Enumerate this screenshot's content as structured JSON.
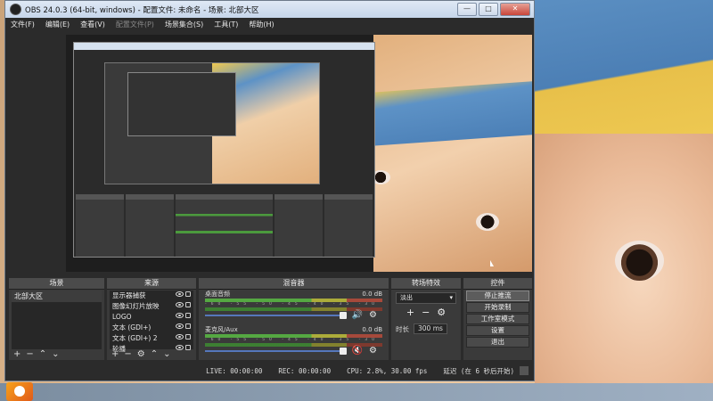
{
  "window": {
    "title": "OBS 24.0.3 (64-bit, windows) - 配置文件: 未命名 - 场景: 北部大区",
    "controls": [
      "—",
      "□",
      "✕"
    ]
  },
  "menu": [
    "文件(F)",
    "编辑(E)",
    "查看(V)",
    "配置文件(P)",
    "场景集合(S)",
    "工具(T)",
    "帮助(H)"
  ],
  "docks": {
    "scenes": {
      "title": "场景",
      "items": [
        "北部大区"
      ]
    },
    "sources": {
      "title": "来源",
      "items": [
        "显示器捕获",
        "图像幻灯片放映",
        "LOGO",
        "文本 (GDI+)",
        "文本 (GDI+) 2",
        "轮播"
      ]
    },
    "mixer": {
      "title": "混音器",
      "tracks": [
        {
          "name": "桌面音频",
          "db": "0.0 dB",
          "muted": false,
          "level": 0.62
        },
        {
          "name": "麦克风/Aux",
          "db": "0.0 dB",
          "muted": true,
          "level": 0.58
        }
      ],
      "scale": "-60 -55 -50 -45 -40 -35 -30 -25 -20 -15 -10 -5 0"
    },
    "transitions": {
      "title": "转场特效",
      "selected": "淡出",
      "duration_label": "时长",
      "duration": "300 ms"
    },
    "controls": {
      "title": "控件",
      "buttons": [
        "停止推流",
        "开始录制",
        "工作室模式",
        "设置",
        "退出"
      ]
    }
  },
  "status": {
    "live": "LIVE: 00:00:00",
    "rec": "REC: 00:00:00",
    "cpu": "CPU: 2.8%, 30.00 fps",
    "delay": "延迟 (在 6 秒后开始)"
  },
  "colors": {
    "meter_green": "#58b443",
    "meter_yellow": "#b9b83a",
    "meter_red": "#b24b3b",
    "panel": "#3a3a3a"
  }
}
